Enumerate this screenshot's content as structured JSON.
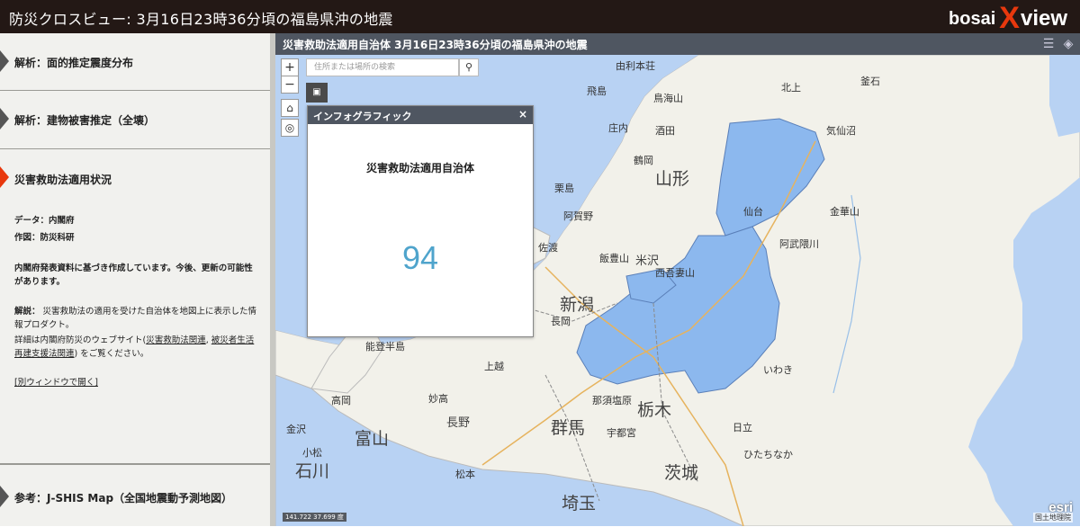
{
  "header": {
    "title": "防災クロスビュー: 3月16日23時36分頃の福島県沖の地震",
    "logo_text_1": "bosai",
    "logo_text_2": "X",
    "logo_text_3": "view"
  },
  "sidebar": {
    "sections": [
      {
        "label": "解析：面的推定震度分布"
      },
      {
        "label": "解析：建物被害推定（全壊）"
      },
      {
        "label": "災害救助法適用状況"
      },
      {
        "label": "参考：J-SHIS Map（全国地震動予測地図）"
      }
    ],
    "detail": {
      "data_label": "データ：内閣府",
      "author_label": "作図：防災科研",
      "note": "内閣府発表資料に基づき作成しています。今後、更新の可能性があります。",
      "desc_prefix": "解説：",
      "desc_text": "災害救助法の適用を受けた自治体を地図上に表示した情報プロダクト。",
      "more_prefix": "詳細は内閣府防災のウェブサイト(",
      "link1": "災害救助法関連",
      "sep": ", ",
      "link2": "被災者生活再建支援法関連",
      "more_suffix": ") をご覧ください。",
      "open_window": "[別ウィンドウで開く]"
    }
  },
  "map": {
    "header_title": "災害救助法適用自治体 3月16日23時36分頃の福島県沖の地震",
    "search_placeholder": "住所または場所の検索",
    "zoom_in": "+",
    "zoom_out": "−",
    "infographic": {
      "title": "インフォグラフィック",
      "close": "×",
      "subtitle": "災害救助法適用自治体",
      "count": "94"
    },
    "labels": [
      "由利本荘",
      "飛島",
      "鳥海山",
      "北上",
      "釜石",
      "庄内",
      "酒田",
      "鶴岡",
      "山形",
      "気仙沼",
      "栗島",
      "阿賀野",
      "新潟",
      "長岡",
      "飯豊山",
      "米沢",
      "西吾妻山",
      "佐渡",
      "能登半島",
      "上越",
      "妙高",
      "高岡",
      "富山",
      "金沢",
      "小松",
      "石川",
      "長野",
      "松本",
      "群馬",
      "栃木",
      "宇都宮",
      "茨城",
      "日立",
      "那須塩原",
      "埼玉",
      "いわき",
      "仙台",
      "阿武隈川",
      "金華山",
      "ひたちなか"
    ],
    "scale_text": "141.722 37.699 度",
    "attribution": "国土地理院",
    "esri": "esri"
  },
  "colors": {
    "accent": "#e8380d",
    "applied_area": "#8cb8ee",
    "header_bar": "#4f5661",
    "sea": "#b8d2f3"
  }
}
